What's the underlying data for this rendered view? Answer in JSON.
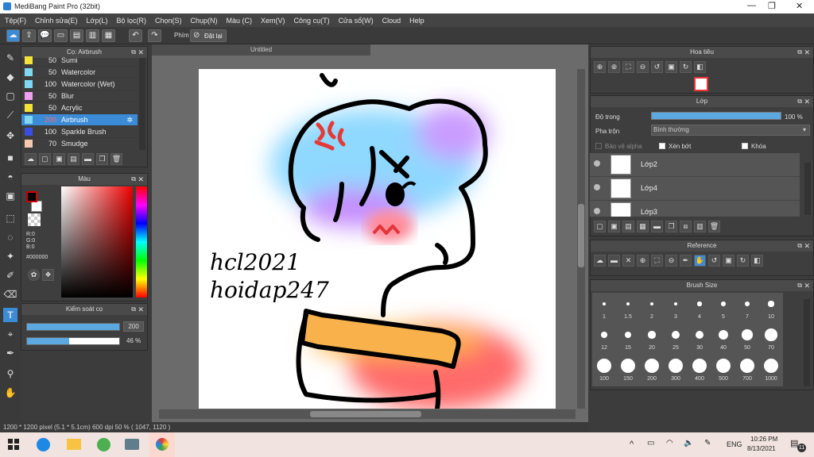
{
  "window": {
    "title": "MediBang Paint Pro (32bit)",
    "minimize": "—",
    "maximize": "❐",
    "close": "✕"
  },
  "menu": [
    "Tệp(F)",
    "Chỉnh sửa(E)",
    "Lớp(L)",
    "Bộ lọc(R)",
    "Chọn(S)",
    "Chụp(N)",
    "Màu (C)",
    "Xem(V)",
    "Công cụ(T)",
    "Cửa sổ(W)",
    "Cloud",
    "Help"
  ],
  "toolbar": {
    "phim_label": "Phím",
    "reset_label": "Đặt lại"
  },
  "brush_panel": {
    "title": "Cọ: Airbrush",
    "items": [
      {
        "size": "50",
        "name": "Sumi",
        "color": "#f2e23a"
      },
      {
        "size": "50",
        "name": "Watercolor",
        "color": "#7fd8f0"
      },
      {
        "size": "100",
        "name": "Watercolor (Wet)",
        "color": "#7fd8f0"
      },
      {
        "size": "50",
        "name": "Blur",
        "color": "#f0a0f0"
      },
      {
        "size": "50",
        "name": "Acrylic",
        "color": "#f2e23a"
      },
      {
        "size": "200",
        "name": "Airbrush",
        "color": "#7fd8f0"
      },
      {
        "size": "100",
        "name": "Sparkle Brush",
        "color": "#3a4fe0"
      },
      {
        "size": "70",
        "name": "Smudge",
        "color": "#f5c8b0"
      }
    ],
    "selected_index": 5
  },
  "color_panel": {
    "title": "Màu",
    "r": "R:0",
    "g": "G:0",
    "b": "B:0",
    "hex": "#000000"
  },
  "brush_control": {
    "title": "Kiểm soát cọ",
    "size_value": "200",
    "opacity_value": "46 %",
    "size_fraction": 1.0,
    "opacity_fraction": 0.46
  },
  "canvas": {
    "tab_title": "Untitled",
    "text_line1": "hcl2021",
    "text_line2": "hoidap247"
  },
  "status": "1200 * 1200 pixel   (5.1 * 5.1cm)  600 dpi  50 %  ( 1047, 1120 )",
  "navigator": {
    "title": "Hoa tiêu"
  },
  "layer_panel": {
    "title": "Lớp",
    "opacity_label": "Độ trong",
    "opacity_value": "100 %",
    "blend_label": "Pha trộn",
    "blend_value": "Bình thường",
    "protect_alpha": "Bảo vệ alpha",
    "clipping": "Xén bớt",
    "lock": "Khóa",
    "layers": [
      {
        "name": "Lớp2"
      },
      {
        "name": "Lớp4"
      },
      {
        "name": "Lớp3"
      }
    ]
  },
  "reference_panel": {
    "title": "Reference"
  },
  "brush_size_panel": {
    "title": "Brush Size",
    "sizes": [
      "1",
      "1.5",
      "2",
      "3",
      "4",
      "5",
      "7",
      "10",
      "12",
      "15",
      "20",
      "25",
      "30",
      "40",
      "50",
      "70",
      "100",
      "150",
      "200",
      "300",
      "400",
      "500",
      "700",
      "1000"
    ]
  },
  "taskbar": {
    "lang": "ENG",
    "time": "10:26 PM",
    "date": "8/13/2021",
    "notif": "11"
  }
}
